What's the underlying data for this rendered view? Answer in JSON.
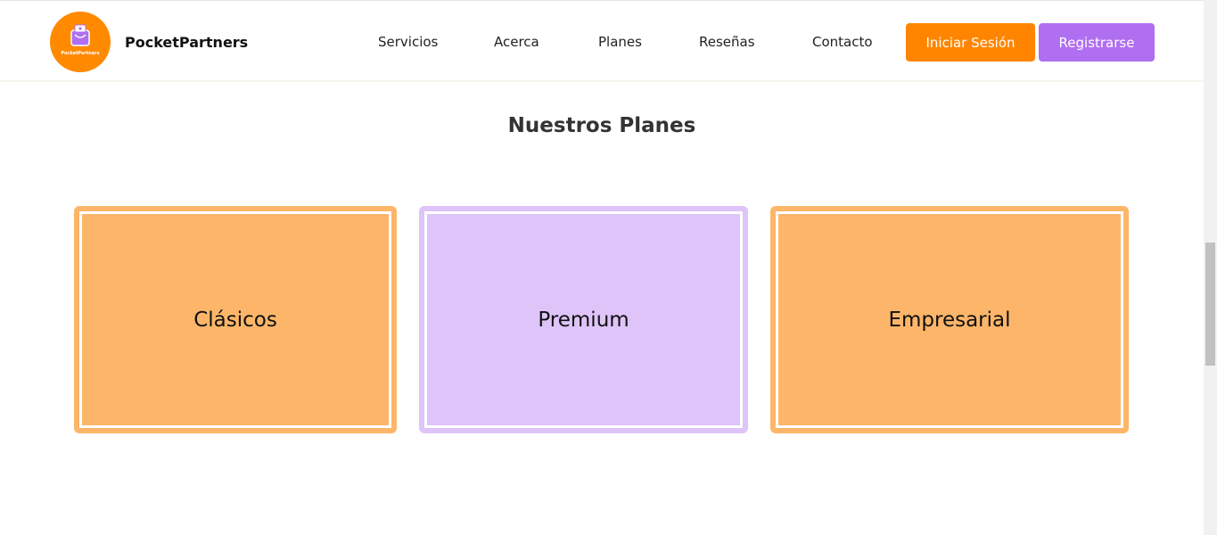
{
  "brand": {
    "name": "PocketPartners",
    "logo_caption": "PocketPartners",
    "logo_color": "#ff8a00"
  },
  "nav": {
    "links": [
      {
        "label": "Servicios"
      },
      {
        "label": "Acerca"
      },
      {
        "label": "Planes"
      },
      {
        "label": "Reseñas"
      },
      {
        "label": "Contacto"
      }
    ],
    "login_label": "Iniciar Sesión",
    "register_label": "Registrarse"
  },
  "plans": {
    "title": "Nuestros Planes",
    "cards": [
      {
        "label": "Clásicos",
        "color": "#fdb669"
      },
      {
        "label": "Premium",
        "color": "#dfc4f9"
      },
      {
        "label": "Empresarial",
        "color": "#fdb669"
      }
    ]
  },
  "colors": {
    "accent_orange": "#ff8500",
    "accent_purple": "#b06ef0"
  }
}
